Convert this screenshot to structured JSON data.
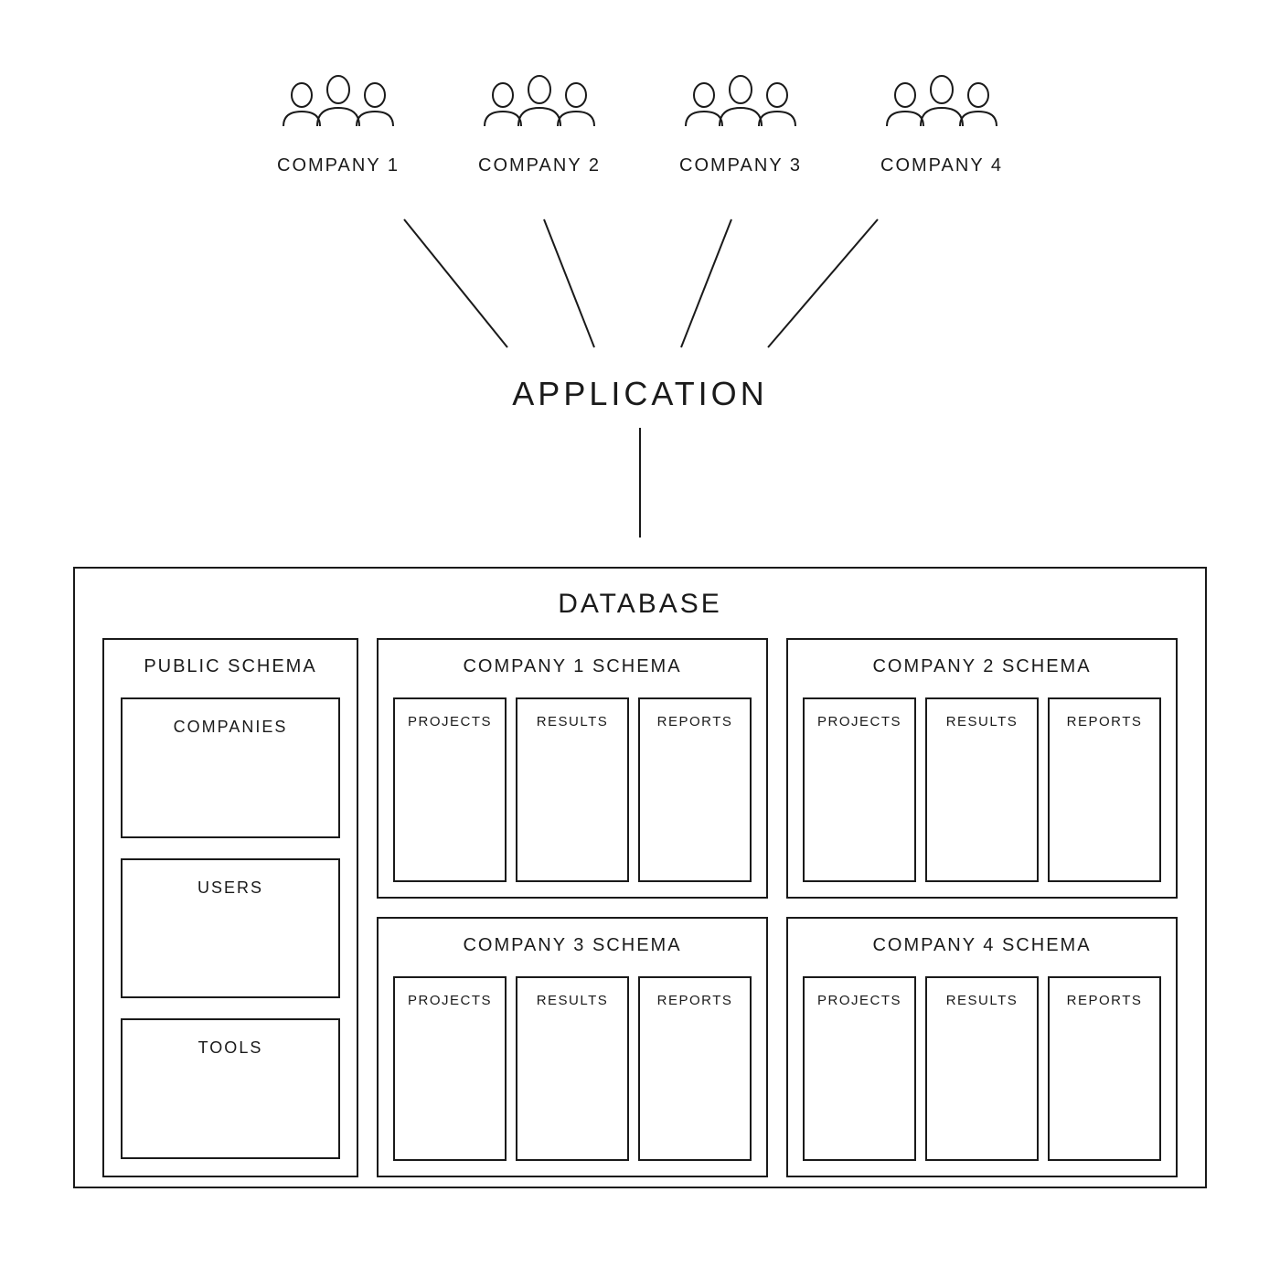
{
  "companies": [
    {
      "label": "COMPANY 1"
    },
    {
      "label": "COMPANY 2"
    },
    {
      "label": "COMPANY 3"
    },
    {
      "label": "COMPANY 4"
    }
  ],
  "application_label": "APPLICATION",
  "database": {
    "title": "DATABASE",
    "public_schema": {
      "title": "PUBLIC SCHEMA",
      "tables": [
        "COMPANIES",
        "USERS",
        "TOOLS"
      ]
    },
    "company_schemas": [
      {
        "title": "COMPANY 1 SCHEMA",
        "tables": [
          "PROJECTS",
          "RESULTS",
          "REPORTS"
        ]
      },
      {
        "title": "COMPANY 2 SCHEMA",
        "tables": [
          "PROJECTS",
          "RESULTS",
          "REPORTS"
        ]
      },
      {
        "title": "COMPANY 3 SCHEMA",
        "tables": [
          "PROJECTS",
          "RESULTS",
          "REPORTS"
        ]
      },
      {
        "title": "COMPANY 4 SCHEMA",
        "tables": [
          "PROJECTS",
          "RESULTS",
          "REPORTS"
        ]
      }
    ]
  }
}
